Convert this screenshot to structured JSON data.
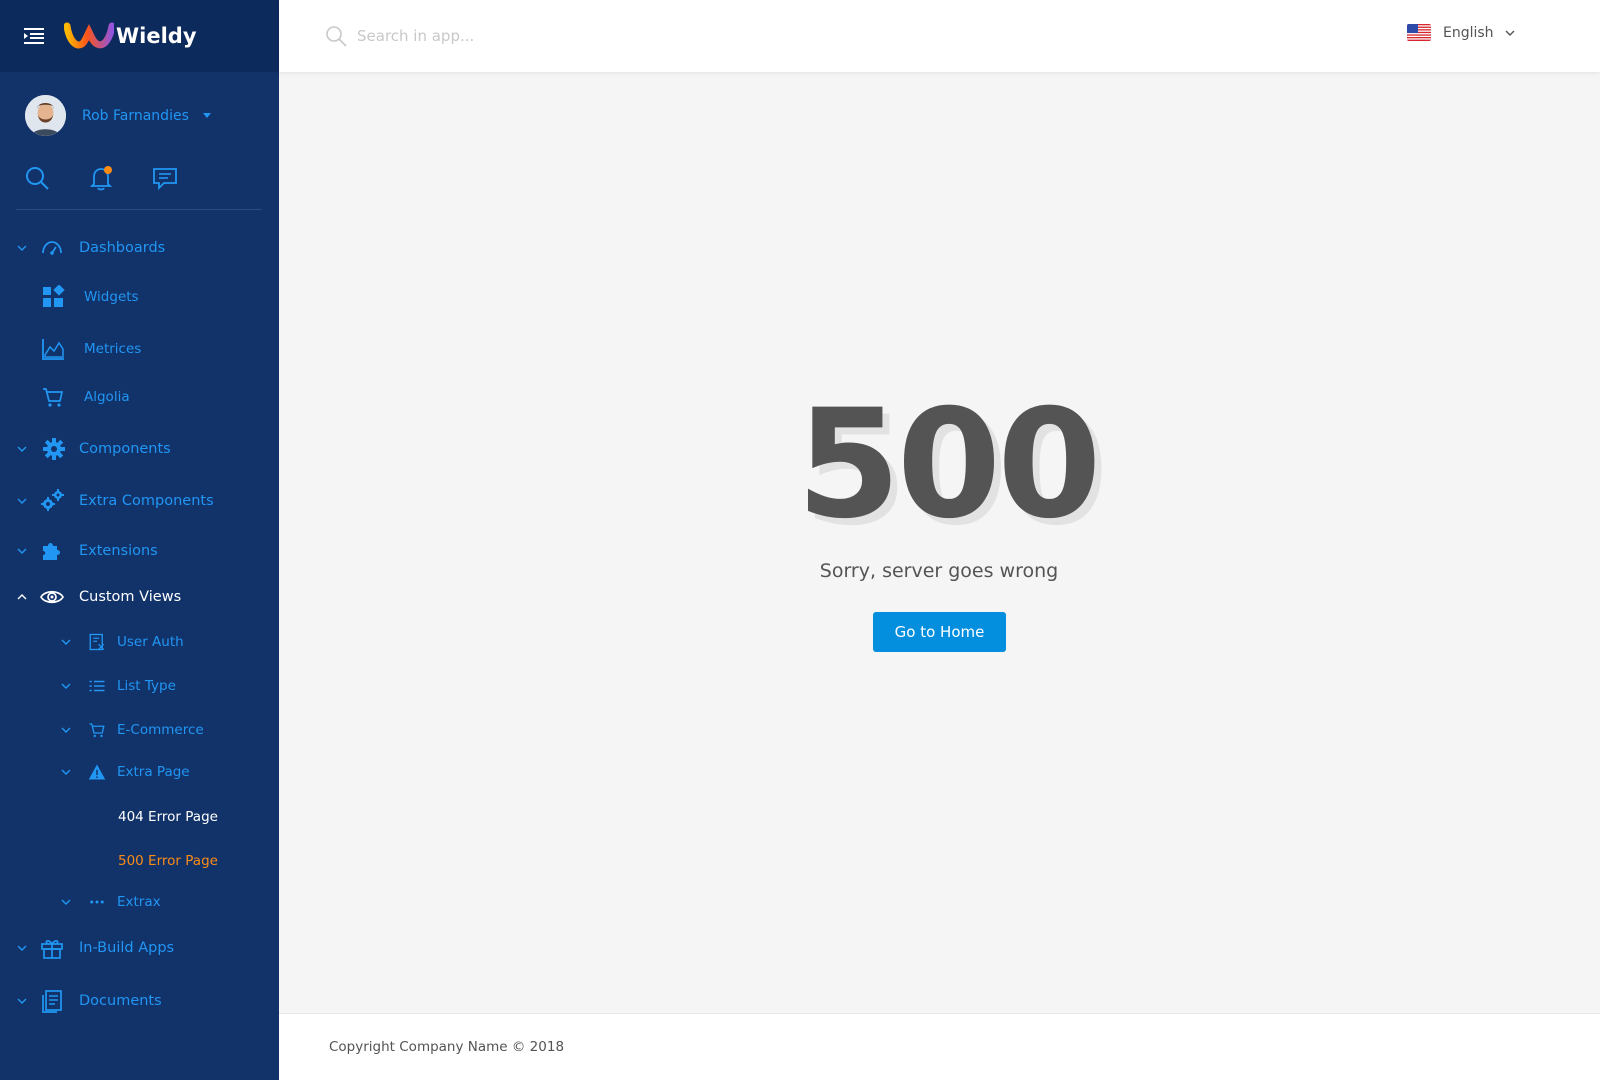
{
  "brand": {
    "name": "Wieldy"
  },
  "user": {
    "name": "Rob Farnandies"
  },
  "search": {
    "placeholder": "Search in app..."
  },
  "language": {
    "label": "English"
  },
  "nav": {
    "dashboards": "Dashboards",
    "widgets": "Widgets",
    "metrices": "Metrices",
    "algolia": "Algolia",
    "components": "Components",
    "extra_components": "Extra Components",
    "extensions": "Extensions",
    "custom_views": "Custom Views",
    "user_auth": "User Auth",
    "list_type": "List Type",
    "ecommerce": "E-Commerce",
    "extra_page": "Extra Page",
    "error_404": "404 Error Page",
    "error_500": "500 Error Page",
    "extrax": "Extrax",
    "inbuild_apps": "In-Build Apps",
    "documents": "Documents"
  },
  "error": {
    "code": "500",
    "message": "Sorry, server goes wrong",
    "button": "Go to Home"
  },
  "footer": {
    "text": "Copyright Company Name © 2018"
  },
  "colors": {
    "sidebar_bg": "#12326a",
    "sidebar_header_bg": "#0d2a5c",
    "accent_blue": "#2196f3",
    "active_orange": "#fa8c16",
    "button_blue": "#038fde",
    "error_text": "#545454"
  },
  "icons": {
    "menu": "menu-fold-icon",
    "search": "search-icon",
    "notification": "bell-icon",
    "messages": "chat-icon",
    "language_flag": "us-flag-icon"
  }
}
